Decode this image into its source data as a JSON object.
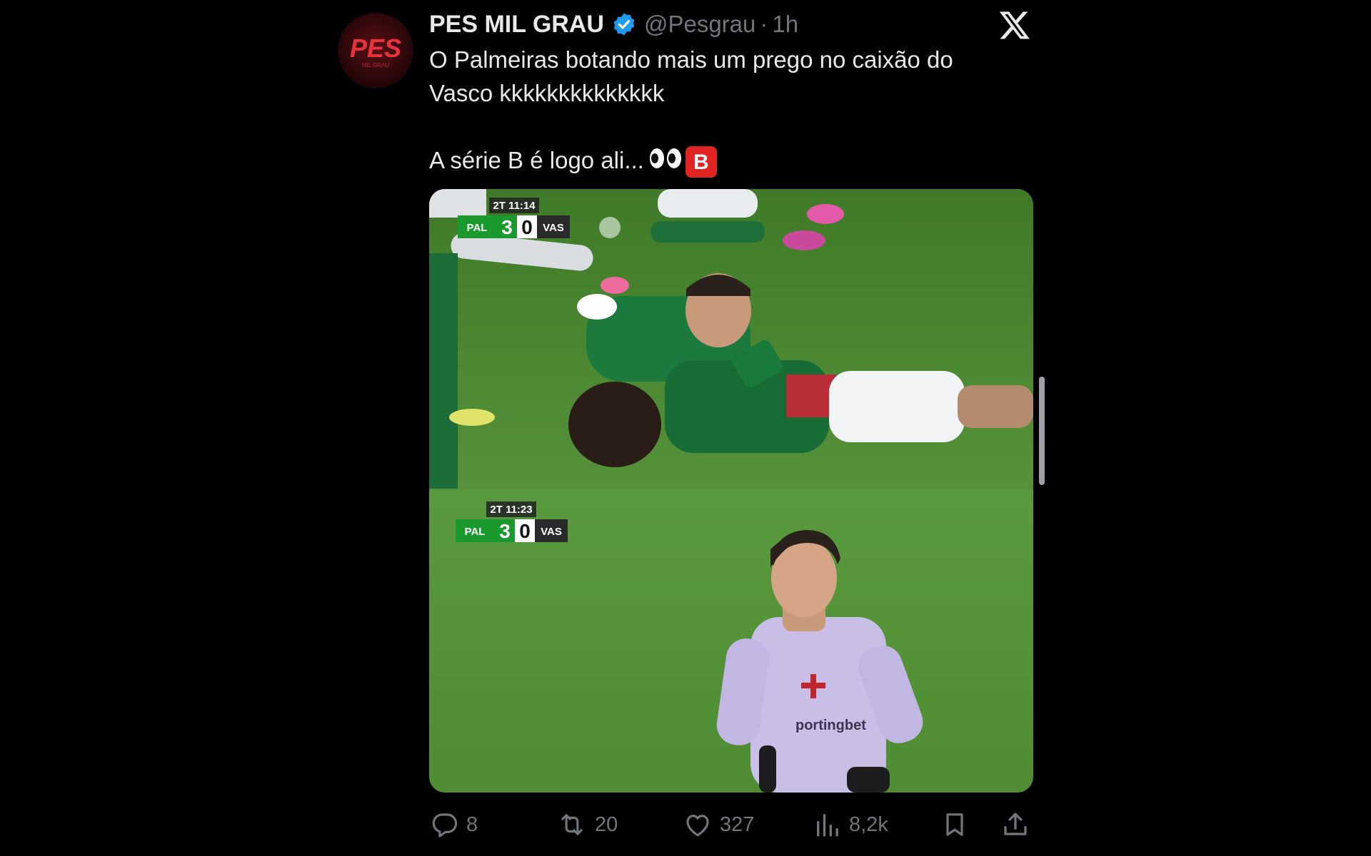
{
  "tweet": {
    "display_name": "PES MIL GRAU",
    "handle": "@Pesgrau",
    "separator": "·",
    "time": "1h",
    "verified": true,
    "avatar_text": "PES",
    "avatar_subtext": "MIL GRAU",
    "text_line1": "O Palmeiras botando mais um prego no caixão do",
    "text_line2": "Vasco kkkkkkkkkkkkkk",
    "text_line3": "A série B é logo ali...",
    "emoji_badge": "B"
  },
  "media": {
    "top_frame": {
      "clock": "2T 11:14",
      "home_team": "PAL",
      "home_score": "3",
      "away_score": "0",
      "away_team": "VAS"
    },
    "bottom_frame": {
      "clock": "2T 11:23",
      "home_team": "PAL",
      "home_score": "3",
      "away_score": "0",
      "away_team": "VAS",
      "sponsor": "portingbet"
    }
  },
  "actions": {
    "replies": "8",
    "reposts": "20",
    "likes": "327",
    "views": "8,2k"
  },
  "colors": {
    "background": "#000000",
    "text_primary": "#e7e9ea",
    "text_secondary": "#71767b",
    "verified": "#1d9bf0",
    "pitch": "#4f8a2f",
    "palmeiras_green": "#1a7a3c"
  },
  "icons": [
    "verified-badge-icon",
    "x-logo-icon",
    "reply-icon",
    "repost-icon",
    "like-icon",
    "views-icon",
    "bookmark-icon",
    "share-icon"
  ]
}
